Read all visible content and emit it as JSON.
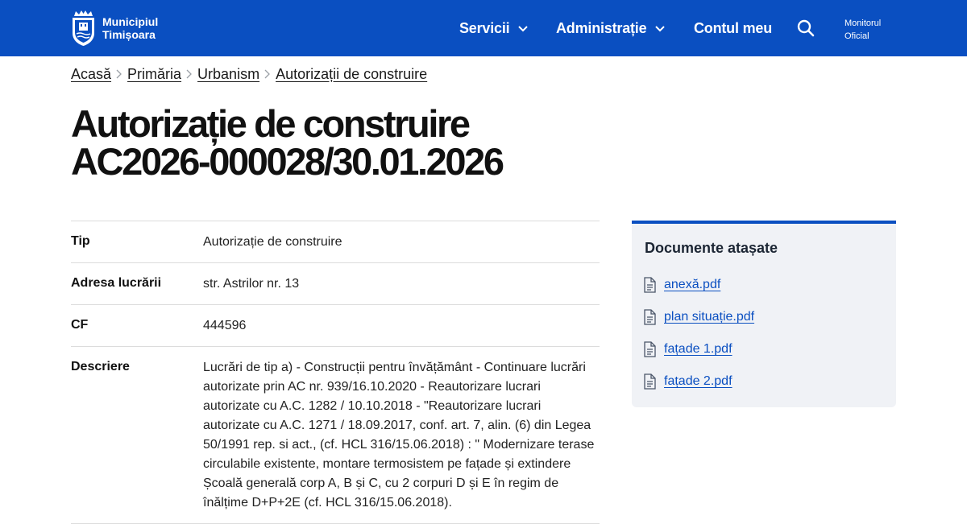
{
  "header": {
    "logo_line1": "Municipiul",
    "logo_line2": "Timișoara",
    "nav": {
      "servicii": "Servicii",
      "administratie": "Administrație",
      "cont": "Contul meu"
    },
    "monitor_line1": "Monitorul",
    "monitor_line2": "Oficial",
    "brand_color": "#0a4fc1"
  },
  "breadcrumb": [
    "Acasă",
    "Primăria",
    "Urbanism",
    "Autorizații de construire"
  ],
  "title": {
    "line1": "Autorizație de construire",
    "line2": "AC2026-000028/30.01.2026"
  },
  "details": [
    {
      "label": "Tip",
      "value": "Autorizație de construire"
    },
    {
      "label": "Adresa lucrării",
      "value": "str. Astrilor nr. 13"
    },
    {
      "label": "CF",
      "value": "444596"
    },
    {
      "label": "Descriere",
      "value": "Lucrări de tip a) - Construcții pentru învățământ - Continuare lucrări autorizate prin AC nr. 939/16.10.2020 - Reautorizare lucrari autorizate cu A.C. 1282 / 10.10.2018 - \"Reautorizare lucrari autorizate cu A.C. 1271 / 18.09.2017, conf. art. 7, alin. (6) din Legea 50/1991 rep. si act., (cf. HCL 316/15.06.2018) : \" Modernizare terase circulabile existente, montare termosistem pe fațade și extindere Școală generală corp A, B și C, cu 2 corpuri D și E în regim de înălțime D+P+2E (cf. HCL 316/15.06.2018)."
    }
  ],
  "documents": {
    "title": "Documente atașate",
    "files": [
      "anexă.pdf",
      "plan situație.pdf",
      "fațade 1.pdf",
      "fațade 2.pdf"
    ]
  }
}
